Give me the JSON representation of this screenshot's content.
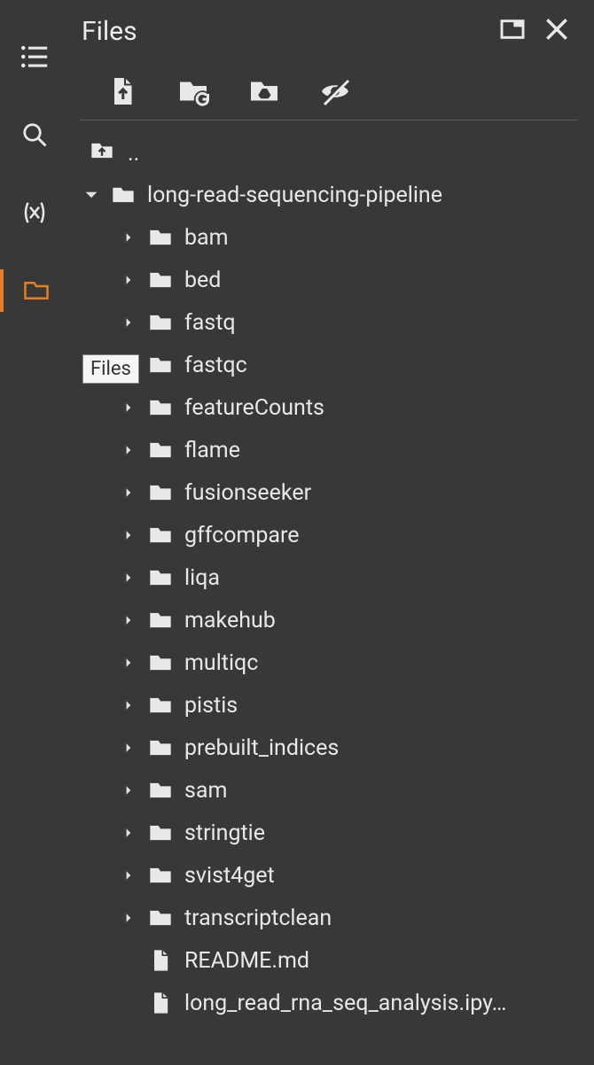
{
  "header": {
    "title": "Files"
  },
  "tooltip": "Files",
  "parent_label": "..",
  "root": {
    "name": "long-read-sequencing-pipeline",
    "expanded": true,
    "children": [
      {
        "type": "folder",
        "name": "bam"
      },
      {
        "type": "folder",
        "name": "bed"
      },
      {
        "type": "folder",
        "name": "fastq"
      },
      {
        "type": "folder",
        "name": "fastqc"
      },
      {
        "type": "folder",
        "name": "featureCounts"
      },
      {
        "type": "folder",
        "name": "flame"
      },
      {
        "type": "folder",
        "name": "fusionseeker"
      },
      {
        "type": "folder",
        "name": "gffcompare"
      },
      {
        "type": "folder",
        "name": "liqa"
      },
      {
        "type": "folder",
        "name": "makehub"
      },
      {
        "type": "folder",
        "name": "multiqc"
      },
      {
        "type": "folder",
        "name": "pistis"
      },
      {
        "type": "folder",
        "name": "prebuilt_indices"
      },
      {
        "type": "folder",
        "name": "sam"
      },
      {
        "type": "folder",
        "name": "stringtie"
      },
      {
        "type": "folder",
        "name": "svist4get"
      },
      {
        "type": "folder",
        "name": "transcriptclean"
      },
      {
        "type": "file",
        "name": "README.md"
      },
      {
        "type": "file",
        "name": "long_read_rna_seq_analysis.ipy…"
      }
    ]
  }
}
